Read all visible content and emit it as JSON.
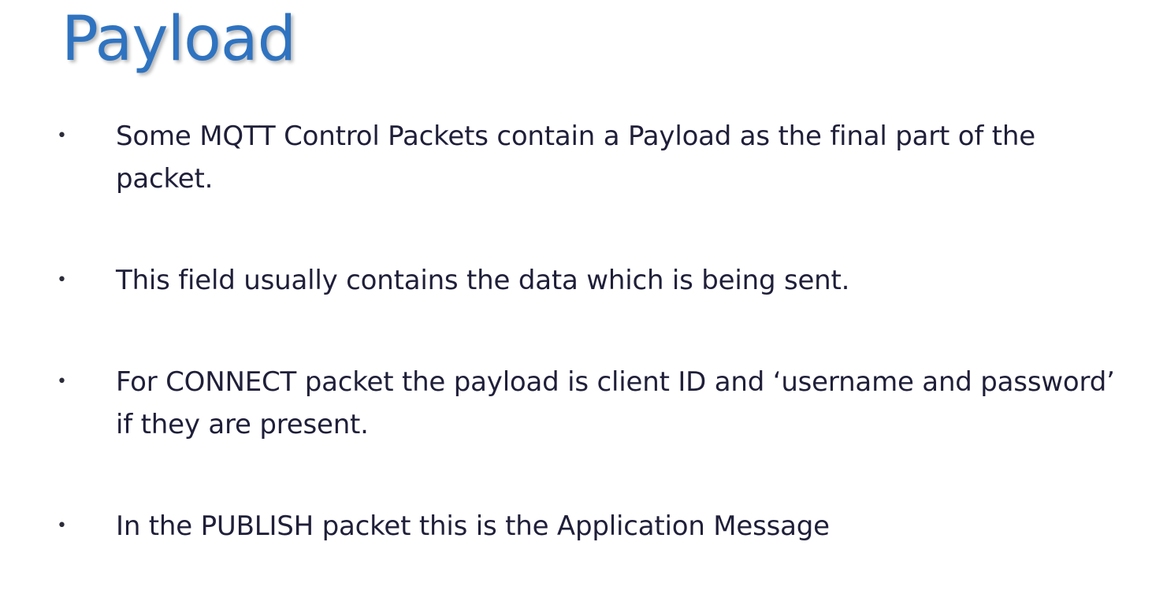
{
  "slide": {
    "title": "Payload",
    "bullets": [
      "Some MQTT Control Packets contain a Payload as the final part of the packet.",
      "This field usually contains the data which is being sent.",
      "For CONNECT packet the payload is client ID and ‘username and password’ if they are present.",
      "In the PUBLISH packet  this is the Application Message"
    ],
    "bullet_marker": "•"
  },
  "colors": {
    "title": "#2f73c0",
    "body_text": "#1f1f3a",
    "background": "#ffffff"
  }
}
